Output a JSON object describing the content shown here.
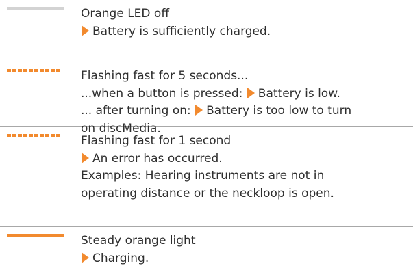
{
  "colors": {
    "accent_orange": "#f28a2e",
    "led_off_gray": "#d3d3d3",
    "divider": "#a8a8a8",
    "text": "#2e2e2e"
  },
  "rows": [
    {
      "indicator": "led-off",
      "lines": [
        {
          "text": "Orange LED off"
        },
        {
          "arrow": true,
          "text": "Battery is sufficiently charged."
        }
      ]
    },
    {
      "indicator": "led-flashing",
      "lines": [
        {
          "text": "Flashing fast for 5 seconds..."
        },
        {
          "prefix": "...when a button is pressed: ",
          "arrow": true,
          "text": "Battery is low."
        },
        {
          "prefix": "... after turning on: ",
          "arrow": true,
          "text": "Battery is too low to turn"
        },
        {
          "text": "on discMedia."
        }
      ]
    },
    {
      "indicator": "led-flashing",
      "lines": [
        {
          "text": "Flashing fast for 1 second"
        },
        {
          "arrow": true,
          "text": "An error has occurred."
        },
        {
          "text": "Examples: Hearing instruments are not in"
        },
        {
          "text": "operating distance or the neckloop is open."
        }
      ]
    },
    {
      "indicator": "led-steady",
      "lines": [
        {
          "text": "Steady orange light"
        },
        {
          "arrow": true,
          "text": "Charging."
        }
      ]
    }
  ]
}
